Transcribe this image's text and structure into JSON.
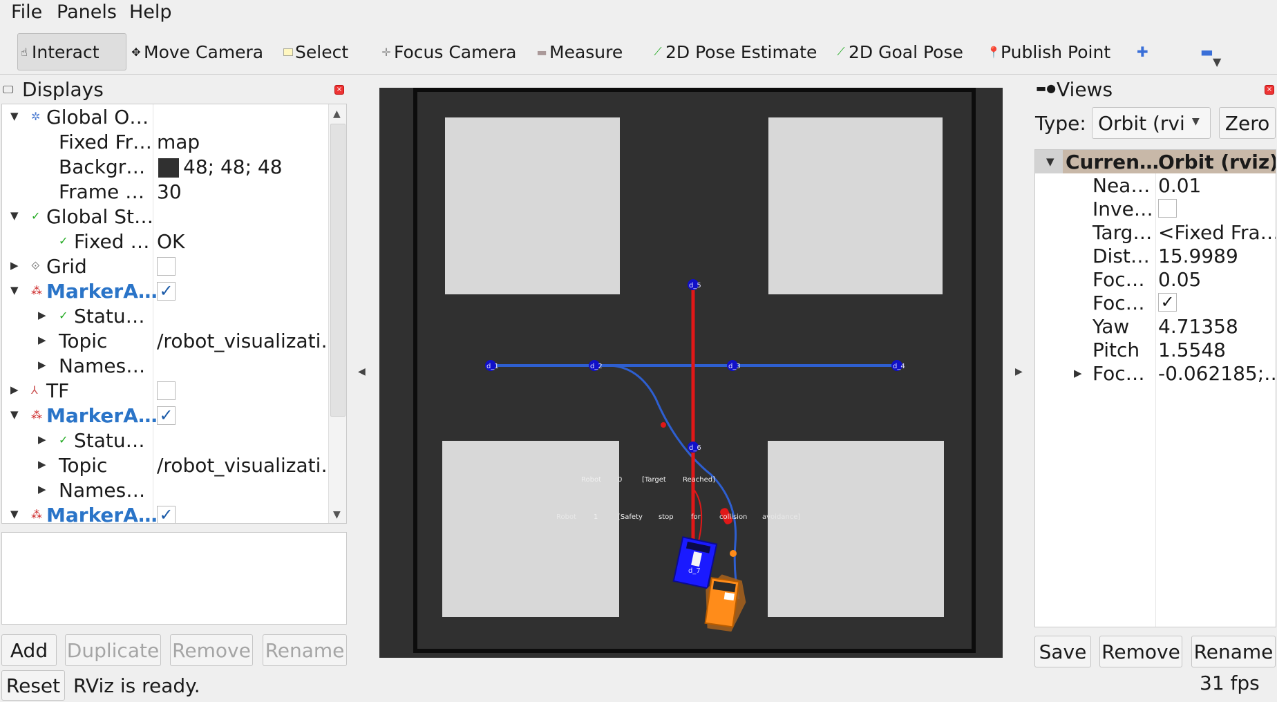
{
  "menu": {
    "file": "File",
    "panels": "Panels",
    "help": "Help"
  },
  "toolbar": {
    "interact": "Interact",
    "move_camera": "Move Camera",
    "select": "Select",
    "focus_camera": "Focus Camera",
    "measure": "Measure",
    "pose_estimate": "2D Pose Estimate",
    "goal_pose": "2D Goal Pose",
    "publish_point": "Publish Point"
  },
  "displays": {
    "title": "Displays",
    "rows": [
      {
        "name": "Global O…",
        "value": ""
      },
      {
        "name": "Fixed Fr…",
        "value": "map"
      },
      {
        "name": "Backgr…",
        "value": "48; 48; 48"
      },
      {
        "name": "Frame …",
        "value": "30"
      },
      {
        "name": "Global St…",
        "value": ""
      },
      {
        "name": "Fixed …",
        "value": "OK"
      },
      {
        "name": "Grid",
        "value": ""
      },
      {
        "name": "MarkerA…",
        "value": ""
      },
      {
        "name": "Statu…",
        "value": ""
      },
      {
        "name": "Topic",
        "value": "/robot_visualizati…"
      },
      {
        "name": "Names…",
        "value": ""
      },
      {
        "name": "TF",
        "value": ""
      },
      {
        "name": "MarkerA…",
        "value": ""
      },
      {
        "name": "Statu…",
        "value": ""
      },
      {
        "name": "Topic",
        "value": "/robot_visualizati…"
      },
      {
        "name": "Names…",
        "value": ""
      },
      {
        "name": "MarkerA…",
        "value": ""
      }
    ],
    "checkmark": "✓",
    "background_color": "#303030",
    "buttons": {
      "add": "Add",
      "duplicate": "Duplicate",
      "remove": "Remove",
      "rename": "Rename"
    }
  },
  "status": {
    "reset": "Reset",
    "message": "RViz is ready.",
    "fps": "31 fps"
  },
  "viewport": {
    "nodes": [
      "d_1",
      "d_2",
      "d_3",
      "d_4",
      "d_5",
      "d_6",
      "d_7"
    ],
    "robot0_text": [
      "Robot",
      "0",
      "[Target",
      "Reached]"
    ],
    "robot1_text": [
      "Robot",
      "1",
      "[Safety",
      "stop",
      "for",
      "collision",
      "avoidance]"
    ]
  },
  "views": {
    "title": "Views",
    "type_label": "Type:",
    "type_value": "Orbit (rviz)",
    "zero": "Zero",
    "rows": [
      {
        "name": "Curren…",
        "value": "Orbit (rviz)"
      },
      {
        "name": "Nea…",
        "value": "0.01"
      },
      {
        "name": "Inve…",
        "value": ""
      },
      {
        "name": "Targ…",
        "value": "<Fixed Fra…"
      },
      {
        "name": "Dist…",
        "value": "15.9989"
      },
      {
        "name": "Foc…",
        "value": "0.05"
      },
      {
        "name": "Foc…",
        "value": ""
      },
      {
        "name": "Yaw",
        "value": "4.71358"
      },
      {
        "name": "Pitch",
        "value": "1.5548"
      },
      {
        "name": "Foc…",
        "value": "-0.062185;…"
      }
    ],
    "buttons": {
      "save": "Save",
      "remove": "Remove",
      "rename": "Rename"
    }
  },
  "colors": {
    "path_blue": "#2e5fd0",
    "path_red": "#e01818",
    "robot0": "#1a1aff",
    "robot1": "#ff8c1a",
    "floor": "#d8d8d8",
    "link_blue": "#2a74c8"
  }
}
